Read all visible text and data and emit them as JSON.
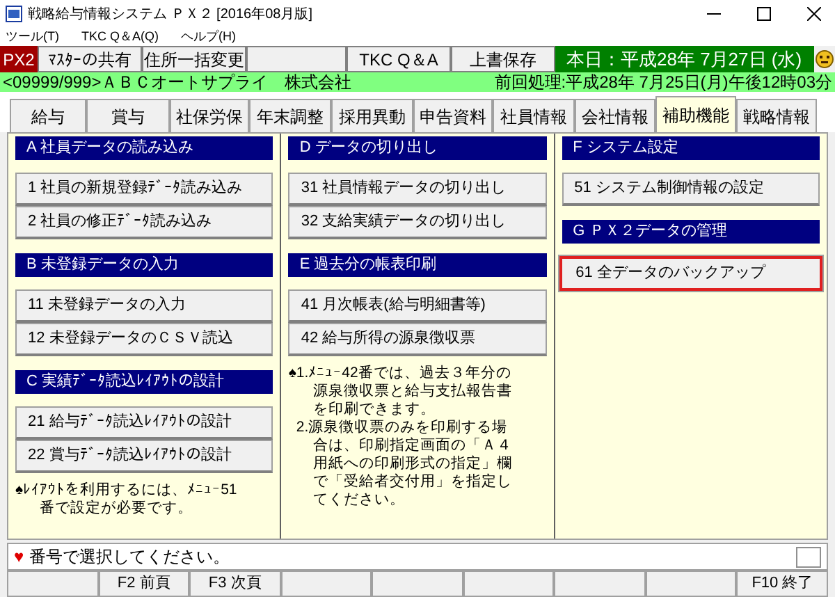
{
  "window": {
    "title": "戦略給与情報システム ＰＸ２ [2016年08月版]"
  },
  "menu": [
    "ツール(T)",
    "TKC Q＆A(Q)",
    "ヘルプ(H)"
  ],
  "toolbar": [
    {
      "kind": "brand",
      "label": "PX2"
    },
    {
      "kind": "button",
      "label": "ﾏｽﾀｰの共有"
    },
    {
      "kind": "button",
      "label": "住所一括変更"
    },
    {
      "kind": "blank"
    },
    {
      "kind": "button",
      "label": "TKC Q＆A"
    },
    {
      "kind": "button",
      "label": "上書保存"
    },
    {
      "kind": "date",
      "label": "本日：平成28年 7月27日 (水)"
    }
  ],
  "company": {
    "name": "<09999/999>ＡＢＣオートサプライ　株式会社",
    "last_processed": "前回処理:平成28年 7月25日(月)午後12時03分"
  },
  "tabs": [
    {
      "label": "給与",
      "selected": false
    },
    {
      "label": "賞与",
      "selected": false
    },
    {
      "label": "社保労保",
      "selected": false
    },
    {
      "label": "年末調整",
      "selected": false
    },
    {
      "label": "採用異動",
      "selected": false
    },
    {
      "label": "申告資料",
      "selected": false
    },
    {
      "label": "社員情報",
      "selected": false
    },
    {
      "label": "会社情報",
      "selected": false
    },
    {
      "label": "補助機能",
      "selected": true
    },
    {
      "label": "戦略情報",
      "selected": false
    }
  ],
  "columns": [
    {
      "sections": [
        {
          "title": "A 社員データの読み込み",
          "buttons": [
            {
              "label": "1 社員の新規登録ﾃﾞｰﾀ読み込み",
              "selected": false
            },
            {
              "label": "2 社員の修正ﾃﾞｰﾀ読み込み",
              "selected": false
            }
          ]
        },
        {
          "title": "B 未登録データの入力",
          "buttons": [
            {
              "label": "11 未登録データの入力",
              "selected": false
            },
            {
              "label": "12 未登録データのＣＳＶ読込",
              "selected": false
            }
          ]
        },
        {
          "title": "C 実績ﾃﾞｰﾀ読込ﾚｲｱｳﾄの設計",
          "buttons": [
            {
              "label": "21 給与ﾃﾞｰﾀ読込ﾚｲｱｳﾄの設計",
              "selected": false
            },
            {
              "label": "22 賞与ﾃﾞｰﾀ読込ﾚｲｱｳﾄの設計",
              "selected": false
            }
          ]
        }
      ],
      "note": {
        "mark": "♠",
        "items": [
          "ﾚｲｱｳﾄを利用するには、ﾒﾆｭｰ51番で設定が必要です。"
        ]
      }
    },
    {
      "sections": [
        {
          "title": "D データの切り出し",
          "buttons": [
            {
              "label": "31 社員情報データの切り出し",
              "selected": false
            },
            {
              "label": "32 支給実績データの切り出し",
              "selected": false
            }
          ]
        },
        {
          "title": "E 過去分の帳表印刷",
          "buttons": [
            {
              "label": "41 月次帳表(給与明細書等)",
              "selected": false
            },
            {
              "label": "42 給与所得の源泉徴収票",
              "selected": false
            }
          ]
        }
      ],
      "note": {
        "mark": "♠",
        "items": [
          "1.ﾒﾆｭｰ42番では、過去３年分の源泉徴収票と給与支払報告書を印刷できます。",
          "2.源泉徴収票のみを印刷する場合は、印刷指定画面の「Ａ４用紙への印刷形式の指定」欄で「受給者交付用」を指定してください。"
        ]
      }
    },
    {
      "sections": [
        {
          "title": "F システム設定",
          "buttons": [
            {
              "label": "51 システム制御情報の設定",
              "selected": false
            }
          ]
        },
        {
          "title": "G ＰＸ２データの管理",
          "buttons": [
            {
              "label": "61 全データのバックアップ",
              "selected": true
            }
          ]
        }
      ]
    }
  ],
  "message": {
    "mark": "♥",
    "text": "番号で選択してください。"
  },
  "function_keys": [
    {
      "kind": "blank"
    },
    {
      "kind": "key",
      "label": "F2 前頁"
    },
    {
      "kind": "key",
      "label": "F3 次頁"
    },
    {
      "kind": "blank"
    },
    {
      "kind": "blank"
    },
    {
      "kind": "blank"
    },
    {
      "kind": "blank"
    },
    {
      "kind": "blank"
    },
    {
      "kind": "key",
      "label": "F10 終了"
    }
  ]
}
